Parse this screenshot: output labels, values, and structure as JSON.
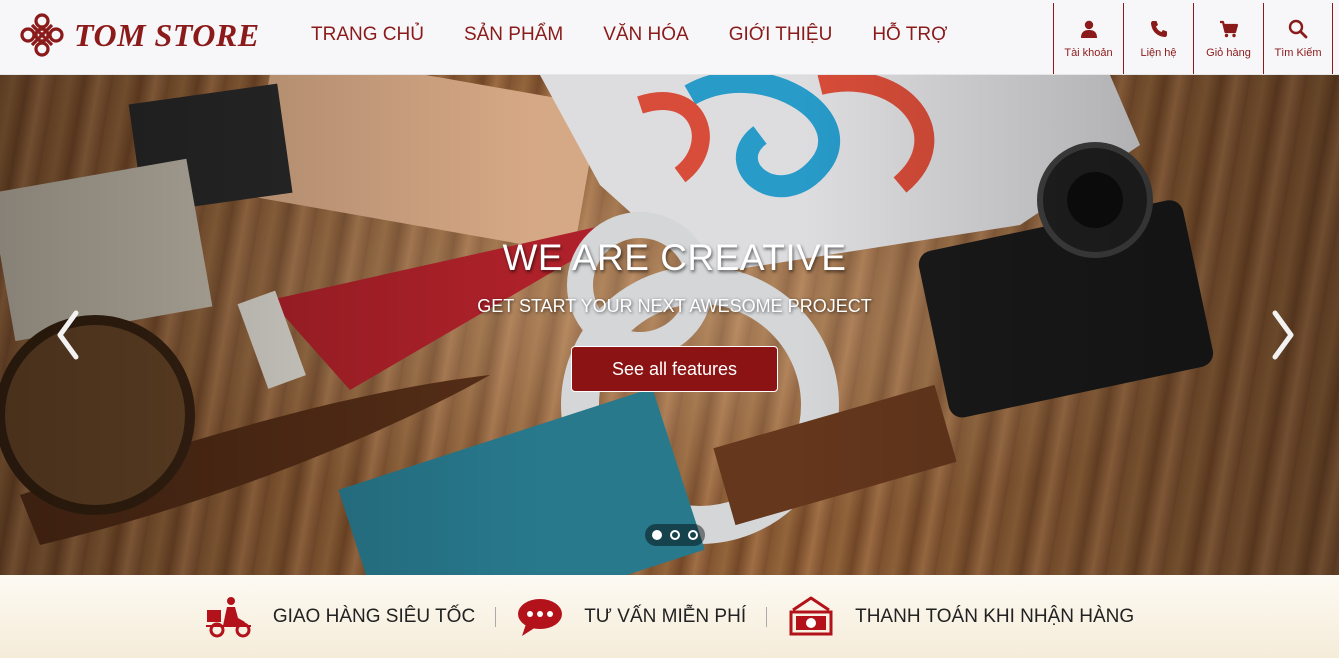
{
  "brand": {
    "name": "TOM STORE",
    "color": "#8b1a1a"
  },
  "nav": {
    "items": [
      {
        "label": "TRANG CHỦ"
      },
      {
        "label": "SẢN PHẨM"
      },
      {
        "label": "VĂN HÓA"
      },
      {
        "label": "GIỚI THIỆU"
      },
      {
        "label": "HỖ TRỢ"
      }
    ]
  },
  "tools": [
    {
      "label": "Tài khoản",
      "icon": "user-icon"
    },
    {
      "label": "Liện hệ",
      "icon": "phone-icon"
    },
    {
      "label": "Giỏ hàng",
      "icon": "cart-icon"
    },
    {
      "label": "Tìm Kiếm",
      "icon": "search-icon"
    }
  ],
  "hero": {
    "title": "WE ARE CREATIVE",
    "subtitle": "GET START YOUR NEXT AWESOME PROJECT",
    "button_label": "See all features",
    "active_slide": 1,
    "slide_count": 3
  },
  "features": [
    {
      "label": "GIAO HÀNG SIÊU TỐC",
      "icon": "delivery-scooter-icon"
    },
    {
      "label": "TƯ VẤN MIỄN PHÍ",
      "icon": "chat-bubble-icon"
    },
    {
      "label": "THANH TOÁN KHI NHẬN HÀNG",
      "icon": "cash-icon"
    }
  ]
}
